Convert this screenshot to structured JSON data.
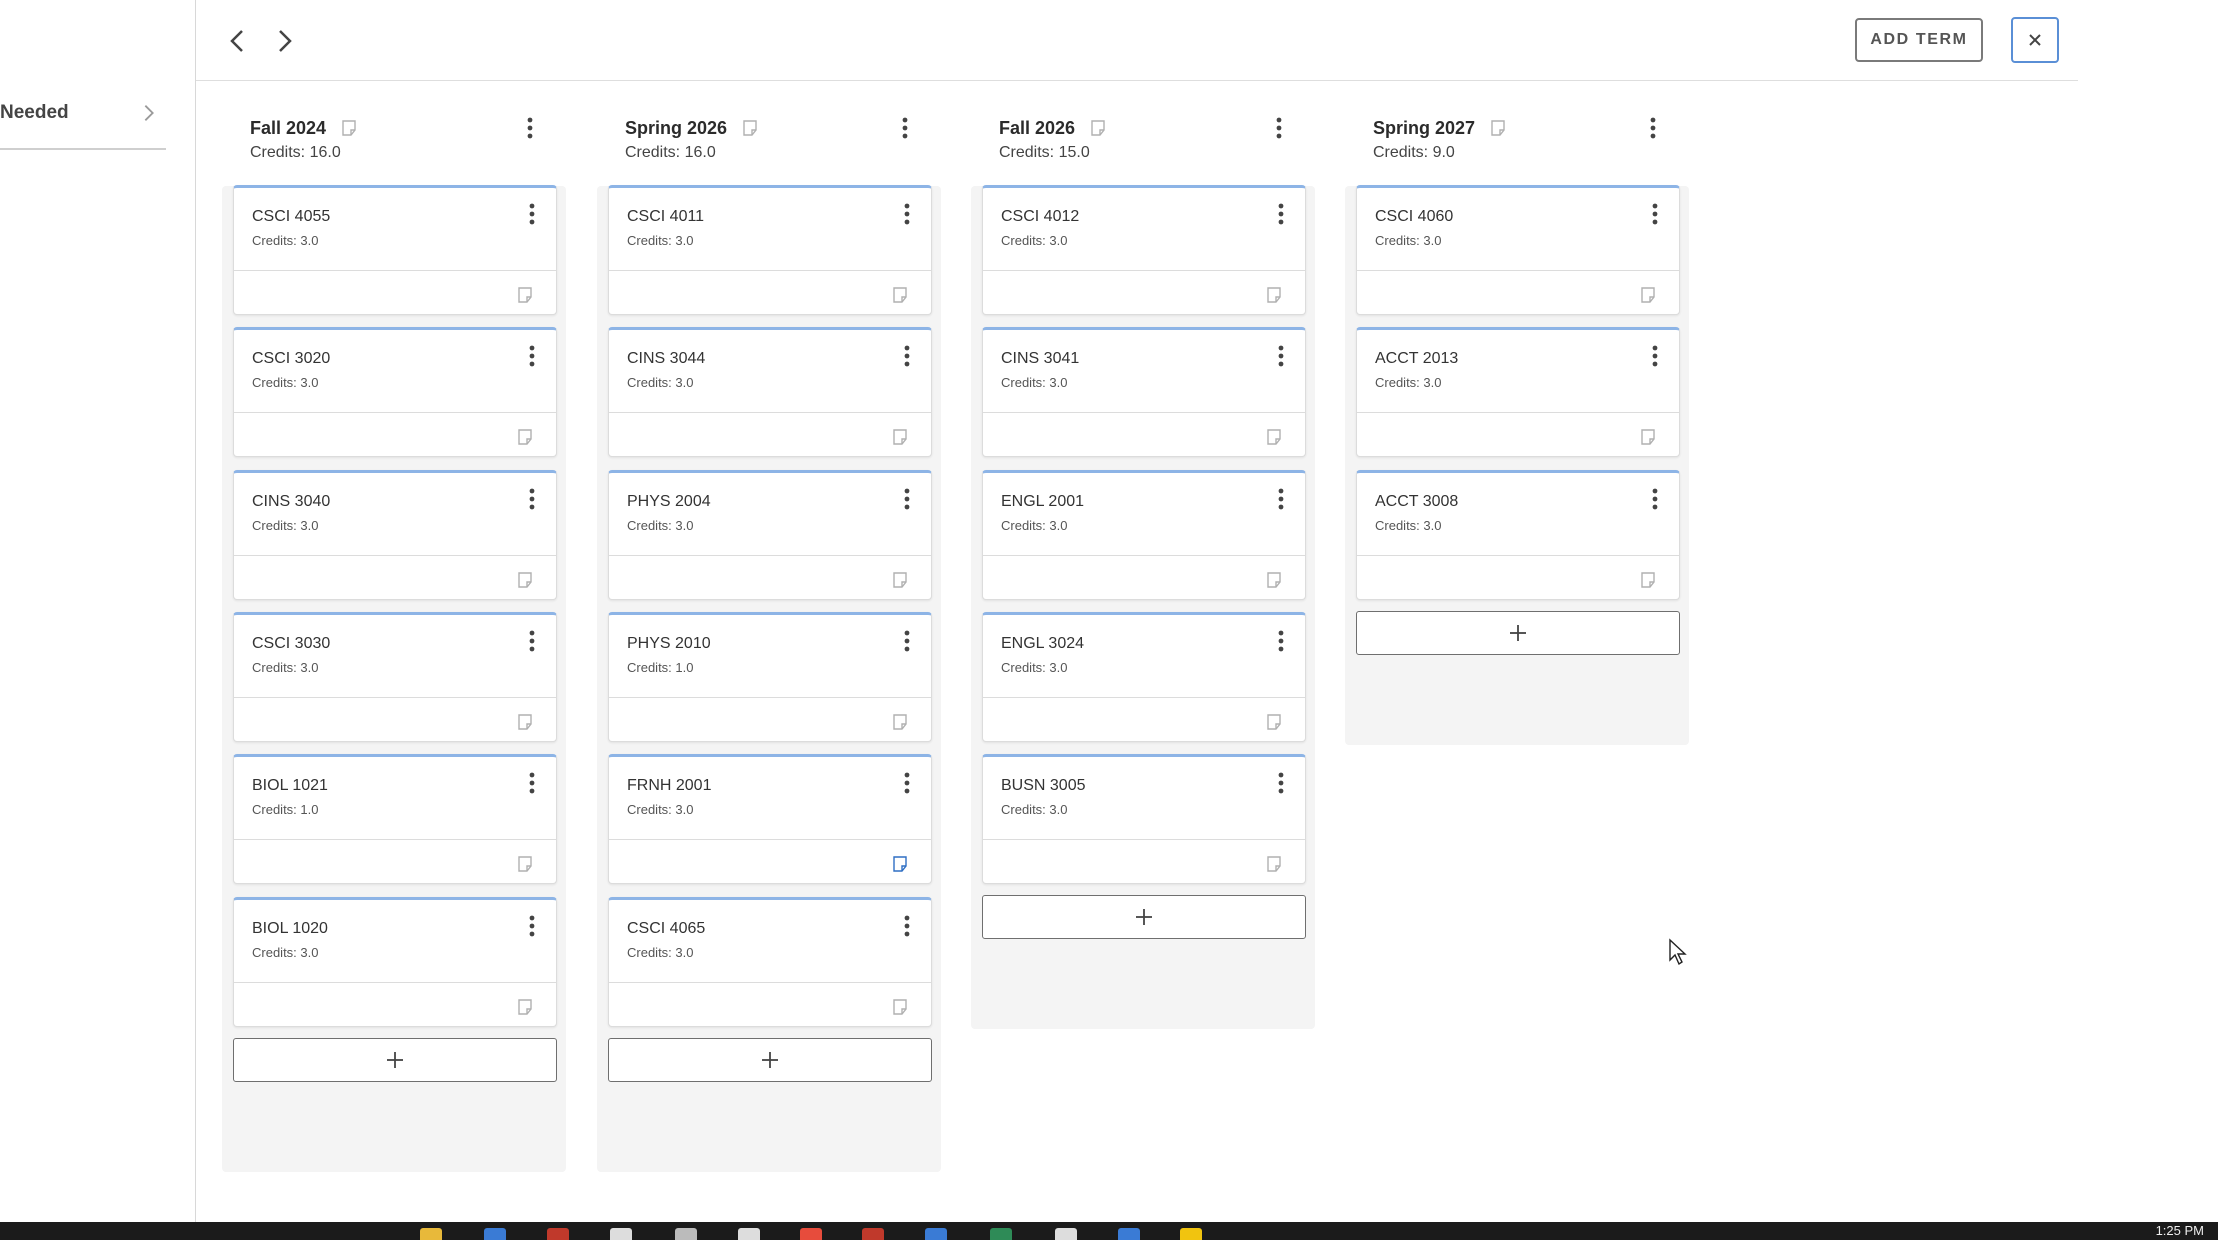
{
  "left_panel": {
    "needed_label": "Needed"
  },
  "toolbar": {
    "add_term_label": "ADD TERM"
  },
  "credits_prefix": "Credits:",
  "terms": [
    {
      "title": "Fall 2024",
      "credits_label": "Credits:  16.0",
      "courses": [
        {
          "code": "CSCI 4055",
          "credits": "Credits: 3.0"
        },
        {
          "code": "CSCI 3020",
          "credits": "Credits: 3.0"
        },
        {
          "code": "CINS 3040",
          "credits": "Credits: 3.0"
        },
        {
          "code": "CSCI 3030",
          "credits": "Credits: 3.0"
        },
        {
          "code": "BIOL 1021",
          "credits": "Credits: 1.0"
        },
        {
          "code": "BIOL 1020",
          "credits": "Credits: 3.0"
        }
      ]
    },
    {
      "title": "Spring 2026",
      "credits_label": "Credits:  16.0",
      "courses": [
        {
          "code": "CSCI 4011",
          "credits": "Credits: 3.0"
        },
        {
          "code": "CINS 3044",
          "credits": "Credits: 3.0"
        },
        {
          "code": "PHYS 2004",
          "credits": "Credits: 3.0"
        },
        {
          "code": "PHYS 2010",
          "credits": "Credits: 1.0"
        },
        {
          "code": "FRNH 2001",
          "credits": "Credits: 3.0",
          "note_active": true
        },
        {
          "code": "CSCI 4065",
          "credits": "Credits: 3.0"
        }
      ]
    },
    {
      "title": "Fall 2026",
      "credits_label": "Credits:  15.0",
      "courses": [
        {
          "code": "CSCI 4012",
          "credits": "Credits: 3.0"
        },
        {
          "code": "CINS 3041",
          "credits": "Credits: 3.0"
        },
        {
          "code": "ENGL 2001",
          "credits": "Credits: 3.0"
        },
        {
          "code": "ENGL 3024",
          "credits": "Credits: 3.0"
        },
        {
          "code": "BUSN 3005",
          "credits": "Credits: 3.0"
        }
      ]
    },
    {
      "title": "Spring 2027",
      "credits_label": "Credits:  9.0",
      "courses": [
        {
          "code": "CSCI 4060",
          "credits": "Credits: 3.0"
        },
        {
          "code": "ACCT 2013",
          "credits": "Credits: 3.0"
        },
        {
          "code": "ACCT 3008",
          "credits": "Credits: 3.0"
        }
      ]
    }
  ],
  "icons": {
    "prev": "chevron-left-icon",
    "next": "chevron-right-icon",
    "close": "close-icon",
    "add": "plus-icon",
    "menu": "kebab-menu-icon",
    "note": "note-icon"
  },
  "colors": {
    "card_accent": "#8db4e6",
    "close_border": "#5a8fd6",
    "note_active": "#2f6fc4",
    "column_bg": "#f4f4f4"
  },
  "taskbar": {
    "time": "1:25 PM"
  }
}
